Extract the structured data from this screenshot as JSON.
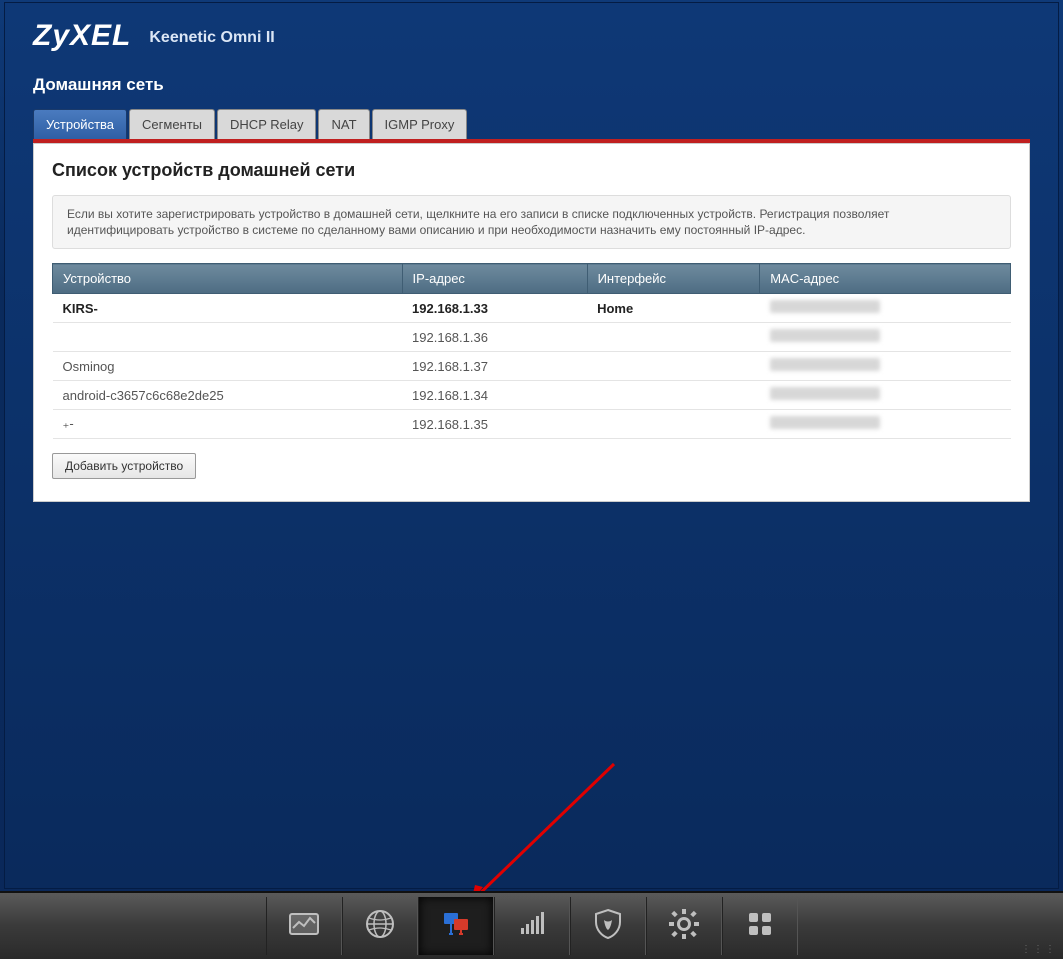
{
  "brand": "ZyXEL",
  "model": "Keenetic Omni II",
  "page_title": "Домашняя сеть",
  "tabs": [
    {
      "label": "Устройства",
      "active": true
    },
    {
      "label": "Сегменты"
    },
    {
      "label": "DHCP Relay"
    },
    {
      "label": "NAT"
    },
    {
      "label": "IGMP Proxy"
    }
  ],
  "panel_heading": "Список устройств домашней сети",
  "info_text": "Если вы хотите зарегистрировать устройство в домашней сети, щелкните на его записи в списке подключенных устройств. Регистрация позволяет идентифицировать устройство в системе по сделанному вами описанию и при необходимости назначить ему постоянный IP-адрес.",
  "columns": {
    "device": "Устройство",
    "ip": "IP-адрес",
    "iface": "Интерфейс",
    "mac": "MAC-адрес"
  },
  "rows": [
    {
      "device": "KIRS-",
      "ip": "192.168.1.33",
      "iface": "Home",
      "mac": "",
      "bold": true
    },
    {
      "device": "",
      "ip": "192.168.1.36",
      "iface": "",
      "mac": ""
    },
    {
      "device": "Osminog",
      "ip": "192.168.1.37",
      "iface": "",
      "mac": ""
    },
    {
      "device": "android-c3657c6c68e2de25",
      "ip": "192.168.1.34",
      "iface": "",
      "mac": ""
    },
    {
      "device": "₊-",
      "ip": "192.168.1.35",
      "iface": "",
      "mac": ""
    }
  ],
  "add_button": "Добавить устройство",
  "nav": [
    {
      "name": "dashboard-icon"
    },
    {
      "name": "globe-icon"
    },
    {
      "name": "network-icon",
      "selected": true
    },
    {
      "name": "wifi-icon"
    },
    {
      "name": "shield-icon"
    },
    {
      "name": "gear-icon"
    },
    {
      "name": "apps-icon"
    }
  ]
}
